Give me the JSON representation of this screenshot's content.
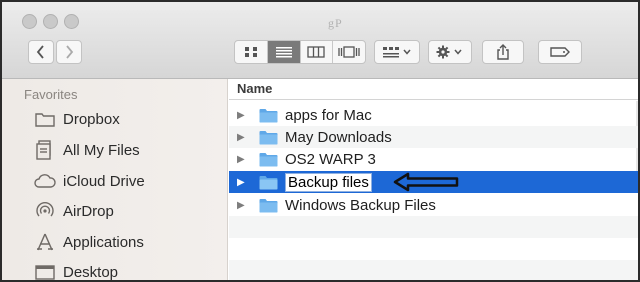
{
  "window": {
    "watermark": "gP"
  },
  "toolbar": {
    "back_icon": "chevron-left-icon",
    "forward_icon": "chevron-right-icon",
    "view_modes": [
      {
        "name": "icon-view",
        "active": false
      },
      {
        "name": "list-view",
        "active": true
      },
      {
        "name": "column-view",
        "active": false
      },
      {
        "name": "cover-flow-view",
        "active": false
      }
    ],
    "arrange_icon": "arrange-grid-icon",
    "action_icon": "gear-icon",
    "share_icon": "share-icon",
    "tags_icon": "tag-icon"
  },
  "sidebar": {
    "section_title": "Favorites",
    "items": [
      {
        "label": "Dropbox",
        "icon": "folder-icon"
      },
      {
        "label": "All My Files",
        "icon": "document-stack-icon"
      },
      {
        "label": "iCloud Drive",
        "icon": "cloud-icon"
      },
      {
        "label": "AirDrop",
        "icon": "airdrop-icon"
      },
      {
        "label": "Applications",
        "icon": "applications-icon"
      },
      {
        "label": "Desktop",
        "icon": "desktop-icon"
      }
    ]
  },
  "file_list": {
    "column_header": "Name",
    "rows": [
      {
        "name": "apps for Mac",
        "selected": false
      },
      {
        "name": "May Downloads",
        "selected": false
      },
      {
        "name": "OS2 WARP 3",
        "selected": false
      },
      {
        "name": "Backup files",
        "selected": true,
        "editing": true
      },
      {
        "name": "Windows Backup Files",
        "selected": false
      }
    ]
  },
  "colors": {
    "selection": "#1d68d6",
    "folder": "#5fa8e8"
  }
}
